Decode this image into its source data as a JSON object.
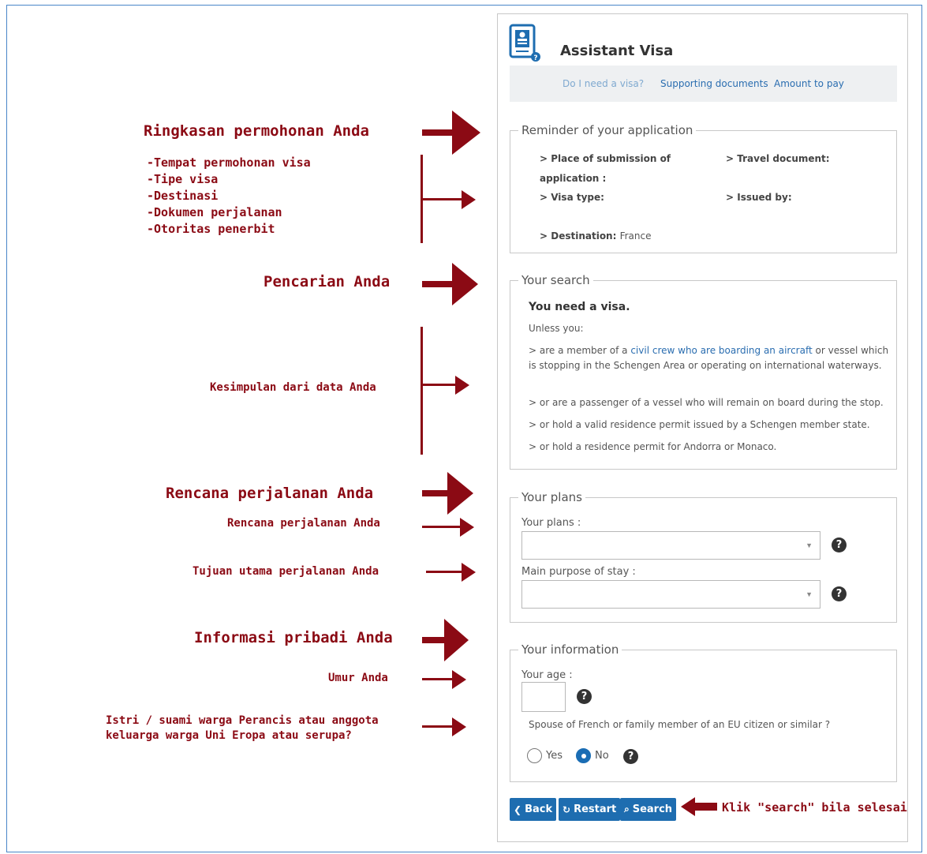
{
  "colors": {
    "annotation": "#8b0a14",
    "link": "#2a6db0",
    "button": "#1e6db0",
    "frame": "#4a86c8"
  },
  "annotations": {
    "reminder_title": "Ringkasan permohonan Anda",
    "reminder_list": [
      "-Tempat permohonan visa",
      "-Tipe visa",
      "-Destinasi",
      "-Dokumen perjalanan",
      "-Otoritas penerbit"
    ],
    "search_title": "Pencarian Anda",
    "conclusion": "Kesimpulan dari data Anda",
    "plans_title": "Rencana perjalanan Anda",
    "plans_item": "Rencana perjalanan Anda",
    "purpose_item": "Tujuan utama perjalanan Anda",
    "info_title": "Informasi pribadi Anda",
    "age_item": "Umur Anda",
    "spouse_line1": "Istri / suami warga Perancis atau anggota",
    "spouse_line2": "keluarga warga Uni Eropa atau serupa?",
    "search_hint": "Klik \"search\" bila selesai"
  },
  "header": {
    "title": "Assistant Visa",
    "icon": "visa-document-icon",
    "tabs": [
      "Do I need a visa?",
      "Supporting documents",
      "Amount to pay"
    ]
  },
  "reminder": {
    "legend": "Reminder of your application",
    "place_label": "> Place of submission of",
    "place_label2": "application :",
    "visa_type_label": "> Visa type:",
    "destination_label": "> Destination:",
    "destination_value": "France",
    "travel_doc_label": "> Travel document:",
    "issued_by_label": "> Issued by:"
  },
  "search": {
    "legend": "Your search",
    "headline": "You need a visa.",
    "unless": "Unless you:",
    "item1_pre": "> are a member of a ",
    "item1_link": "civil crew who are boarding an aircraft",
    "item1_post": " or vessel which is stopping in the Schengen Area or operating on international waterways.",
    "item2": "> or are a passenger of a vessel who will remain on board during the stop.",
    "item3": "> or hold a valid residence permit issued by a Schengen member state.",
    "item4": "> or hold a residence permit for Andorra or Monaco."
  },
  "plans": {
    "legend": "Your plans",
    "plans_label": "Your plans :",
    "plans_value": "",
    "purpose_label": "Main purpose of stay :",
    "purpose_value": ""
  },
  "info": {
    "legend": "Your information",
    "age_label": "Your age :",
    "age_value": "",
    "spouse_question": "Spouse of French or family member of an EU citizen or similar ?",
    "yes_label": "Yes",
    "no_label": "No",
    "selected": "No"
  },
  "buttons": {
    "back": "Back",
    "restart": "Restart",
    "search": "Search"
  },
  "help_glyph": "?"
}
